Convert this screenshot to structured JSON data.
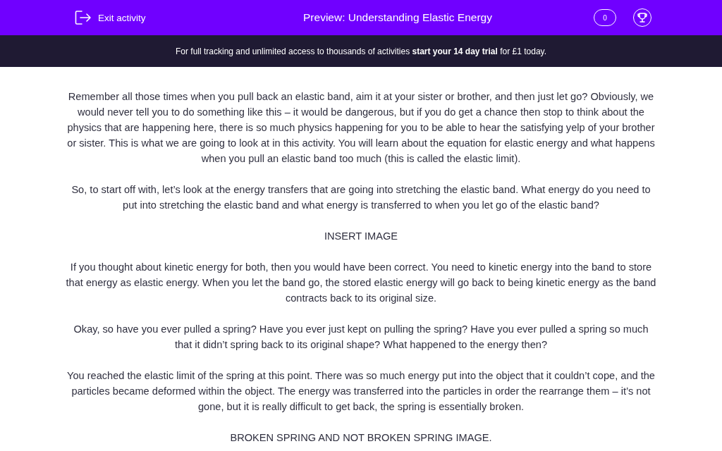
{
  "header": {
    "exit_label": "Exit activity",
    "title": "Preview: Understanding Elastic Energy",
    "score": "0"
  },
  "banner": {
    "text": "For full tracking and unlimited access to thousands of activities **start your 14 day trial** for £1 today."
  },
  "paragraphs": [
    "Remember all those times when you pull back an elastic band, aim it at your sister or brother, and then just let go? Obviously, we would never tell you to do something like this – it would be dangerous, but if you do get a chance then stop to think about the physics that are happening here, there is so much physics happening for you to be able to hear the satisfying yelp of your brother or sister. This is what we are going to look at in this activity. You will learn about the equation for elastic energy and what happens when you pull an elastic band too much (this is called the elastic limit).",
    "So, to start off with, let’s look at the energy transfers that are going into stretching the elastic band. What energy do you need to put into stretching the elastic band and what energy is transferred to when you let go of the elastic band?",
    "INSERT IMAGE",
    "If you thought about kinetic energy for both, then you would have been correct. You need to kinetic energy into the band to store that energy as elastic energy. When you let the band go, the stored elastic energy will go back to being kinetic energy as the band contracts back to its original size.",
    "Okay, so have you ever pulled a spring? Have you ever just kept on pulling the spring? Have you ever pulled a spring so much that it didn’t spring back to its original shape? What happened to the energy then?",
    "You reached the elastic limit of the spring at this point. There was so much energy put into the object that it couldn’t cope, and the particles became deformed within the object. The energy was transferred into the particles in order the rearrange them – it’s not gone, but it is really difficult to get back, the spring is essentially broken.",
    "BROKEN SPRING AND NOT BROKEN SPRING IMAGE."
  ]
}
